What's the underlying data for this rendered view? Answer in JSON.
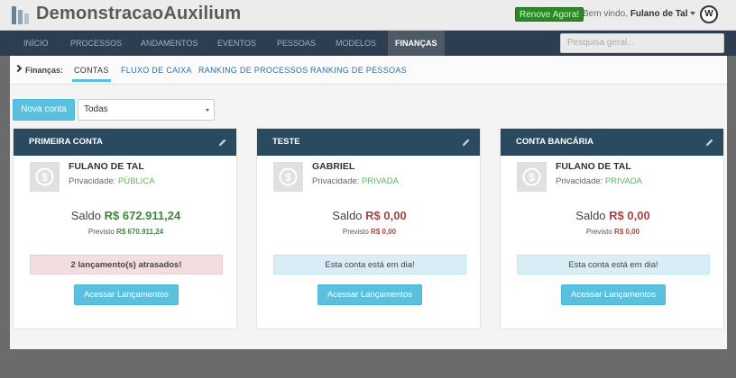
{
  "header": {
    "brand": "DemonstracaoAuxilium",
    "renew_label": "Renove Agora!",
    "welcome_prefix": "Bem vindo,",
    "user_name": "Fulano de Tal"
  },
  "nav": {
    "items": [
      {
        "label": "Início"
      },
      {
        "label": "Processos"
      },
      {
        "label": "Andamentos"
      },
      {
        "label": "Eventos"
      },
      {
        "label": "Pessoas"
      },
      {
        "label": "Modelos"
      },
      {
        "label": "Finanças",
        "active": true
      }
    ],
    "search_placeholder": "Pesquisa geral..."
  },
  "subnav": {
    "label": "Finanças:",
    "tabs": [
      {
        "label": "Contas",
        "active": true
      },
      {
        "label": "Fluxo de caixa"
      },
      {
        "label": "Ranking de processos"
      },
      {
        "label": "Ranking de pessoas"
      }
    ]
  },
  "toolbar": {
    "new_label": "Nova conta",
    "filter_value": "Todas"
  },
  "cards": [
    {
      "title": "Primeira conta",
      "owner": "Fulano de Tal",
      "privacy_label": "Privacidade:",
      "privacy_value": "Pública",
      "saldo_label": "Saldo",
      "saldo_value": "R$ 672.911,24",
      "previsto_label": "Previsto",
      "previsto_value": "R$ 670.911,24",
      "status": "2 lançamento(s) atrasados!",
      "button_label": "Acessar Lançamentos"
    },
    {
      "title": "Teste",
      "owner": "Gabriel",
      "privacy_label": "Privacidade:",
      "privacy_value": "Privada",
      "saldo_label": "Saldo",
      "saldo_value": "R$ 0,00",
      "previsto_label": "Previsto",
      "previsto_value": "R$ 0,00",
      "status": "Esta conta está em dia!",
      "button_label": "Acessar Lançamentos"
    },
    {
      "title": "Conta bancária",
      "owner": "Fulano de Tal",
      "privacy_label": "Privacidade:",
      "privacy_value": "Privada",
      "saldo_label": "Saldo",
      "saldo_value": "R$ 0,00",
      "previsto_label": "Previsto",
      "previsto_value": "R$ 0,00",
      "status": "Esta conta está em dia!",
      "button_label": "Acessar Lançamentos"
    }
  ],
  "colors": {
    "nav_bg": "#2c3e50",
    "card_header": "#2a4a60",
    "button_info": "#5bc0de",
    "positive": "#3a8a3a",
    "negative": "#a94442",
    "privacy": "#5cb85c"
  }
}
